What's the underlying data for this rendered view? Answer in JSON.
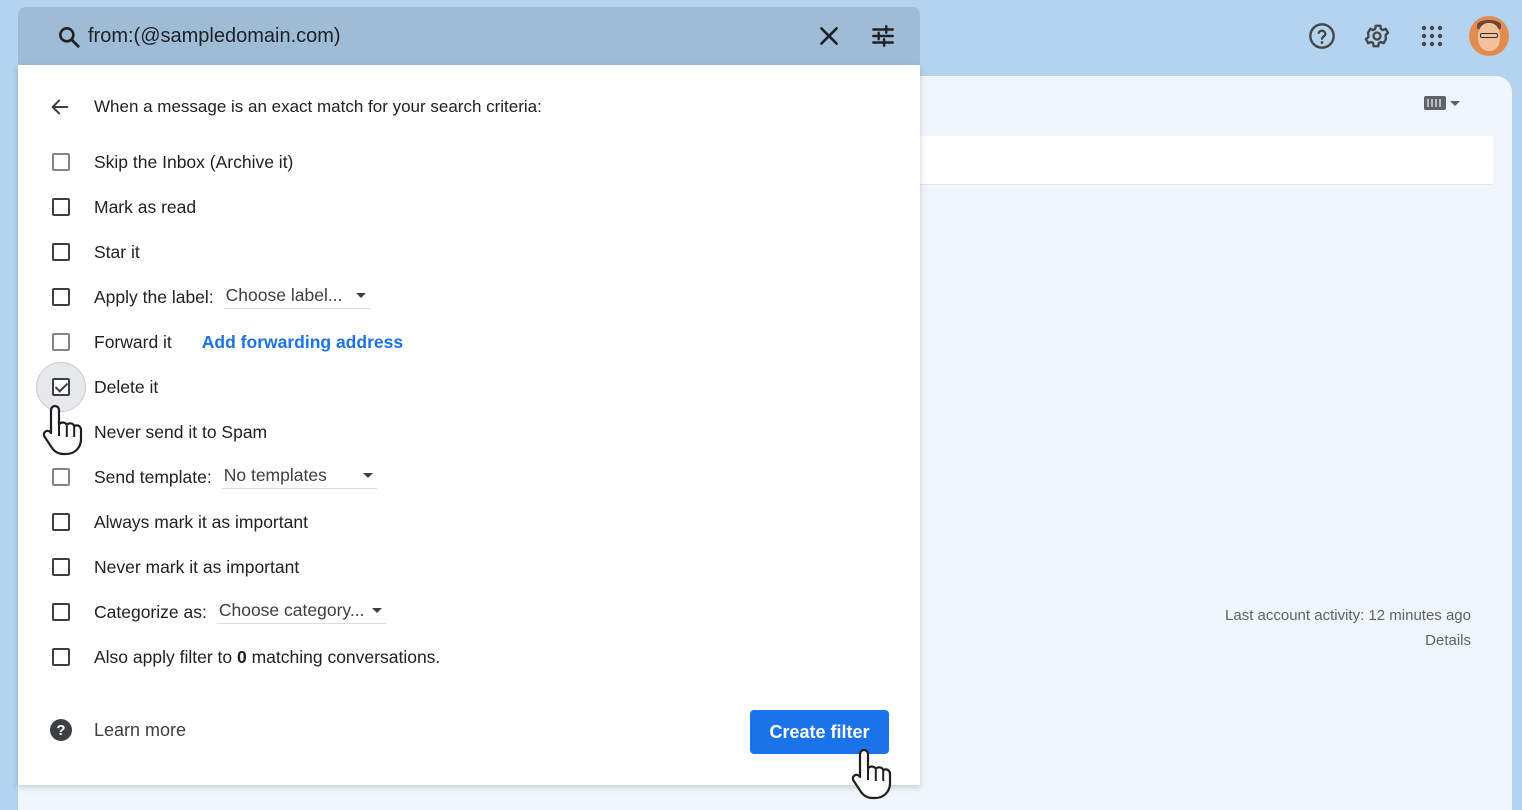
{
  "search": {
    "value": "from:(@sampledomain.com)",
    "clear_icon": "close-icon",
    "options_icon": "tune-icon"
  },
  "top_icons": [
    "help-icon",
    "gear-icon",
    "apps-grid-icon",
    "avatar"
  ],
  "filter": {
    "header": "When a message is an exact match for your search criteria:",
    "options": [
      {
        "label": "Skip the Inbox (Archive it)",
        "checked": false
      },
      {
        "label": "Mark as read",
        "checked": false
      },
      {
        "label": "Star it",
        "checked": false
      },
      {
        "label": "Apply the label:",
        "checked": false,
        "dropdown": "Choose label..."
      },
      {
        "label": "Forward it",
        "checked": false,
        "link": "Add forwarding address"
      },
      {
        "label": "Delete it",
        "checked": true
      },
      {
        "label": "Never send it to Spam",
        "checked": false
      },
      {
        "label": "Send template:",
        "checked": false,
        "dropdown": "No templates"
      },
      {
        "label": "Always mark it as important",
        "checked": false
      },
      {
        "label": "Never mark it as important",
        "checked": false
      },
      {
        "label": "Categorize as:",
        "checked": false,
        "dropdown": "Choose category..."
      },
      {
        "label_prefix": "Also apply filter to ",
        "count": "0",
        "label_suffix": " matching conversations.",
        "checked": false
      }
    ],
    "learn_more": "Learn more",
    "help_glyph": "?",
    "create_button": "Create filter"
  },
  "activity": {
    "text": "Last account activity: 12 minutes ago",
    "details": "Details"
  },
  "colors": {
    "accent": "#1a73e8",
    "background": "#b3d3ee",
    "search_bar": "#9fbcd7"
  }
}
